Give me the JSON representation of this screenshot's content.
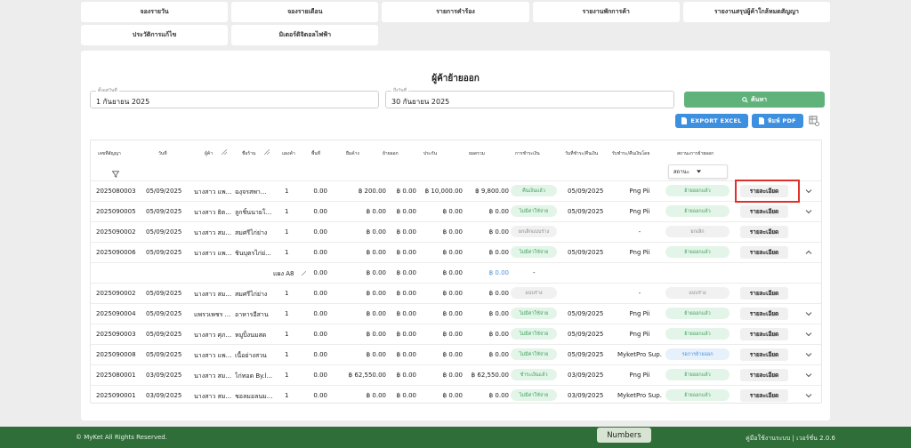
{
  "nav": [
    "จองรายวัน",
    "จองรายเดือน",
    "รายการคำร้อง",
    "รายงานพักการค้า",
    "รายงานสรุปผู้ค้าใกล้หมดสัญญา",
    "ประวัติการแก้ไข",
    "มิเตอร์ดิจิตอลไฟฟ้า"
  ],
  "page_title": "ผู้ค้าย้ายออก",
  "filters": {
    "start_label": "ตั้งแต่วันที่",
    "start_value": "1 กันยายน 2025",
    "end_label": "ถึงวันที่",
    "end_value": "30 กันยายน 2025",
    "search_label": "ค้นหา",
    "export_label": "EXPORT EXCEL",
    "pdf_label": "พิมพ์ PDF"
  },
  "columns": [
    "เลขที่สัญญา",
    "วันที่",
    "ผู้ค้า",
    "ชื่อร้าน",
    "แผงค้า",
    "พื้นที่",
    "ยืมค้าง",
    "ย้ายออก",
    "ประกัน",
    "ยอดรวม",
    "การชำระเงิน",
    "วันที่ชำระ/คืนเงิน",
    "รับชำระ/คืนเงินโดย",
    "สถานะการย้ายออก"
  ],
  "status_filter": "สถานะ",
  "rows": [
    {
      "contract": "2025080003",
      "date": "05/09/2025",
      "vendor": "นางสาว แพ...",
      "shop": "ฉงุจรสพา...",
      "stall": "1",
      "area": "0.00",
      "owed": "฿ 200.00",
      "moveout": "฿ 0.00",
      "deposit": "฿ 10,000.00",
      "total": "฿ 9,800.00",
      "payment": "คืนเงินแล้ว",
      "paydate": "05/09/2025",
      "by": "Png Pii",
      "status": "ย้ายออกแล้ว",
      "detail": "รายละเอียด"
    },
    {
      "contract": "2025090005",
      "date": "05/09/2025",
      "vendor": "นางสาว ธิต...",
      "shop": "ลูกชิ้นนายโ...",
      "stall": "1",
      "area": "0.00",
      "owed": "฿ 0.00",
      "moveout": "฿ 0.00",
      "deposit": "฿ 0.00",
      "total": "฿ 0.00",
      "payment": "ไม่มีค่าใช้จ่าย",
      "paydate": "05/09/2025",
      "by": "Png Pii",
      "status": "ย้ายออกแล้ว",
      "detail": "รายละเอียด"
    },
    {
      "contract": "2025090002",
      "date": "05/09/2025",
      "vendor": "นางสาว สม...",
      "shop": "สมศรีไก่ย่าง",
      "stall": "1",
      "area": "0.00",
      "owed": "฿ 0.00",
      "moveout": "฿ 0.00",
      "deposit": "฿ 0.00",
      "total": "฿ 0.00",
      "payment": "ยกเลิกแบบร่าง",
      "paydate": "",
      "by": "-",
      "status": "ยกเลิก",
      "detail": "รายละเอียด"
    },
    {
      "contract": "2025090006",
      "date": "05/09/2025",
      "vendor": "นางสาว แพ...",
      "shop": "ชินบุตรไก่ย่...",
      "stall": "1",
      "area": "0.00",
      "owed": "฿ 0.00",
      "moveout": "฿ 0.00",
      "deposit": "฿ 0.00",
      "total": "฿ 0.00",
      "payment": "ไม่มีค่าใช้จ่าย",
      "paydate": "05/09/2025",
      "by": "Png Pii",
      "status": "ย้ายออกแล้ว",
      "detail": "รายละเอียด"
    },
    {
      "sub": true,
      "stall": "แผง A8",
      "area": "0.00",
      "owed": "฿ 0.00",
      "moveout": "฿ 0.00",
      "deposit": "฿ 0.00",
      "total": "฿ 0.00",
      "payment": "-"
    },
    {
      "contract": "2025090002",
      "date": "05/09/2025",
      "vendor": "นางสาว สม...",
      "shop": "สมศรีไก่ย่าง",
      "stall": "1",
      "area": "0.00",
      "owed": "฿ 0.00",
      "moveout": "฿ 0.00",
      "deposit": "฿ 0.00",
      "total": "฿ 0.00",
      "payment": "แบบร่าง",
      "paydate": "",
      "by": "-",
      "status": "แบบร่าง",
      "detail": "รายละเอียด"
    },
    {
      "contract": "2025090004",
      "date": "05/09/2025",
      "vendor": "แพรวเพชร ...",
      "shop": "อาหารอีสาน",
      "stall": "1",
      "area": "0.00",
      "owed": "฿ 0.00",
      "moveout": "฿ 0.00",
      "deposit": "฿ 0.00",
      "total": "฿ 0.00",
      "payment": "ไม่มีค่าใช้จ่าย",
      "paydate": "05/09/2025",
      "by": "Png Pii",
      "status": "ย้ายออกแล้ว",
      "detail": "รายละเอียด"
    },
    {
      "contract": "2025090003",
      "date": "05/09/2025",
      "vendor": "นางสาว ศุภ...",
      "shop": "หมูปิ้งนมสด",
      "stall": "1",
      "area": "0.00",
      "owed": "฿ 0.00",
      "moveout": "฿ 0.00",
      "deposit": "฿ 0.00",
      "total": "฿ 0.00",
      "payment": "ไม่มีค่าใช้จ่าย",
      "paydate": "05/09/2025",
      "by": "Png Pii",
      "status": "ย้ายออกแล้ว",
      "detail": "รายละเอียด"
    },
    {
      "contract": "2025090008",
      "date": "05/09/2025",
      "vendor": "นางสาว แพ...",
      "shop": "เนื้อย่างสวน",
      "stall": "1",
      "area": "0.00",
      "owed": "฿ 0.00",
      "moveout": "฿ 0.00",
      "deposit": "฿ 0.00",
      "total": "฿ 0.00",
      "payment": "ไม่มีค่าใช้จ่าย",
      "paydate": "05/09/2025",
      "by": "MyketPro Sup...",
      "status": "รอการย้ายออก",
      "detail": "รายละเอียด"
    },
    {
      "contract": "2025080001",
      "date": "03/09/2025",
      "vendor": "นางสาว สม...",
      "shop": "ไก่ทอด By.l...",
      "stall": "1",
      "area": "0.00",
      "owed": "฿ 62,550.00",
      "moveout": "฿ 0.00",
      "deposit": "฿ 0.00",
      "total": "฿ 62,550.00",
      "payment": "ชำระเงินแล้ว",
      "paydate": "03/09/2025",
      "by": "Png Pii",
      "status": "ย้ายออกแล้ว",
      "detail": "รายละเอียด"
    },
    {
      "contract": "2025090001",
      "date": "03/09/2025",
      "vendor": "นางสาว สม...",
      "shop": "ชอลมอลนม...",
      "stall": "1",
      "area": "0.00",
      "owed": "฿ 0.00",
      "moveout": "฿ 0.00",
      "deposit": "฿ 0.00",
      "total": "฿ 0.00",
      "payment": "ไม่มีค่าใช้จ่าย",
      "paydate": "03/09/2025",
      "by": "MyketPro Sup...",
      "status": "ย้ายออกแล้ว",
      "detail": "รายละเอียด"
    }
  ],
  "footer": {
    "copyright": "© MyKet All Rights Reserved.",
    "manual": "คู่มือใช้งานระบบ | เวอร์ชั่น 2.0.6"
  },
  "numbers_tab": "Numbers",
  "colors": {
    "accent_green": "#5fb37a",
    "blue": "#3d8fe0",
    "footer": "#2f6e39",
    "highlight": "#e0302a"
  }
}
